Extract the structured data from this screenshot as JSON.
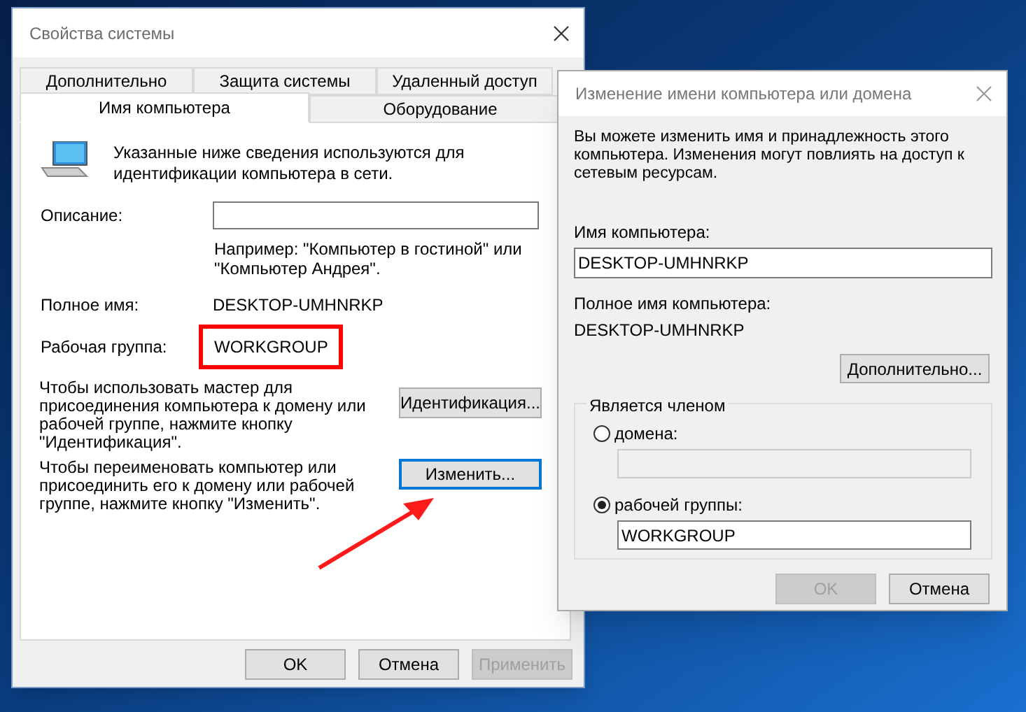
{
  "system_properties": {
    "title": "Свойства системы",
    "tabs_row_1": [
      {
        "label": "Дополнительно",
        "selected": false
      },
      {
        "label": "Защита системы",
        "selected": false
      },
      {
        "label": "Удаленный доступ",
        "selected": false
      }
    ],
    "tabs_row_2": [
      {
        "label": "Имя компьютера",
        "selected": true
      },
      {
        "label": "Оборудование",
        "selected": false
      }
    ],
    "intro": "Указанные ниже сведения используются для\nидентификации компьютера в сети.",
    "description_label": "Описание:",
    "example": "Например: \"Компьютер в гостиной\" или\n\"Компьютер Андрея\".",
    "full_name_label": "Полное имя:",
    "full_name": "DESKTOP-UMHNRKP",
    "workgroup_label": "Рабочая группа:",
    "workgroup": {
      "text": "WORKGROUP",
      "highlighted": true
    },
    "wizard_text": "Чтобы использовать мастер для\nприсоединения компьютера к домену или\nрабочей группе, нажмите кнопку\n\"Идентификация\".",
    "wizard_button": {
      "label": "Идентификация...",
      "focused": false
    },
    "rename_text": "Чтобы переименовать компьютер или\nприсоединить его к домену или рабочей\nгруппе, нажмите кнопку \"Изменить\".",
    "rename_button": {
      "label": "Изменить...",
      "focused": true
    },
    "buttons": [
      {
        "label": "OK",
        "disabled": false
      },
      {
        "label": "Отмена",
        "disabled": false
      },
      {
        "label": "Применить",
        "disabled": true
      }
    ]
  },
  "rename_dialog": {
    "title": "Изменение имени компьютера или домена",
    "intro": "Вы можете изменить имя и принадлежность этого\nкомпьютера. Изменения могут повлиять на доступ к\nсетевым ресурсам.",
    "computer_name_label": "Имя компьютера:",
    "computer_name": "DESKTOP-UMHNRKP",
    "full_name_label": "Полное имя компьютера:",
    "full_name": "DESKTOP-UMHNRKP",
    "more_button": "Дополнительно...",
    "member_of": {
      "legend": "Является членом",
      "options": [
        {
          "label": "домена:",
          "selected": false
        },
        {
          "label": "рабочей группы:",
          "selected": true,
          "value": "WORKGROUP"
        }
      ]
    },
    "buttons": [
      {
        "label": "OK",
        "disabled": true
      },
      {
        "label": "Отмена",
        "disabled": false
      }
    ]
  }
}
